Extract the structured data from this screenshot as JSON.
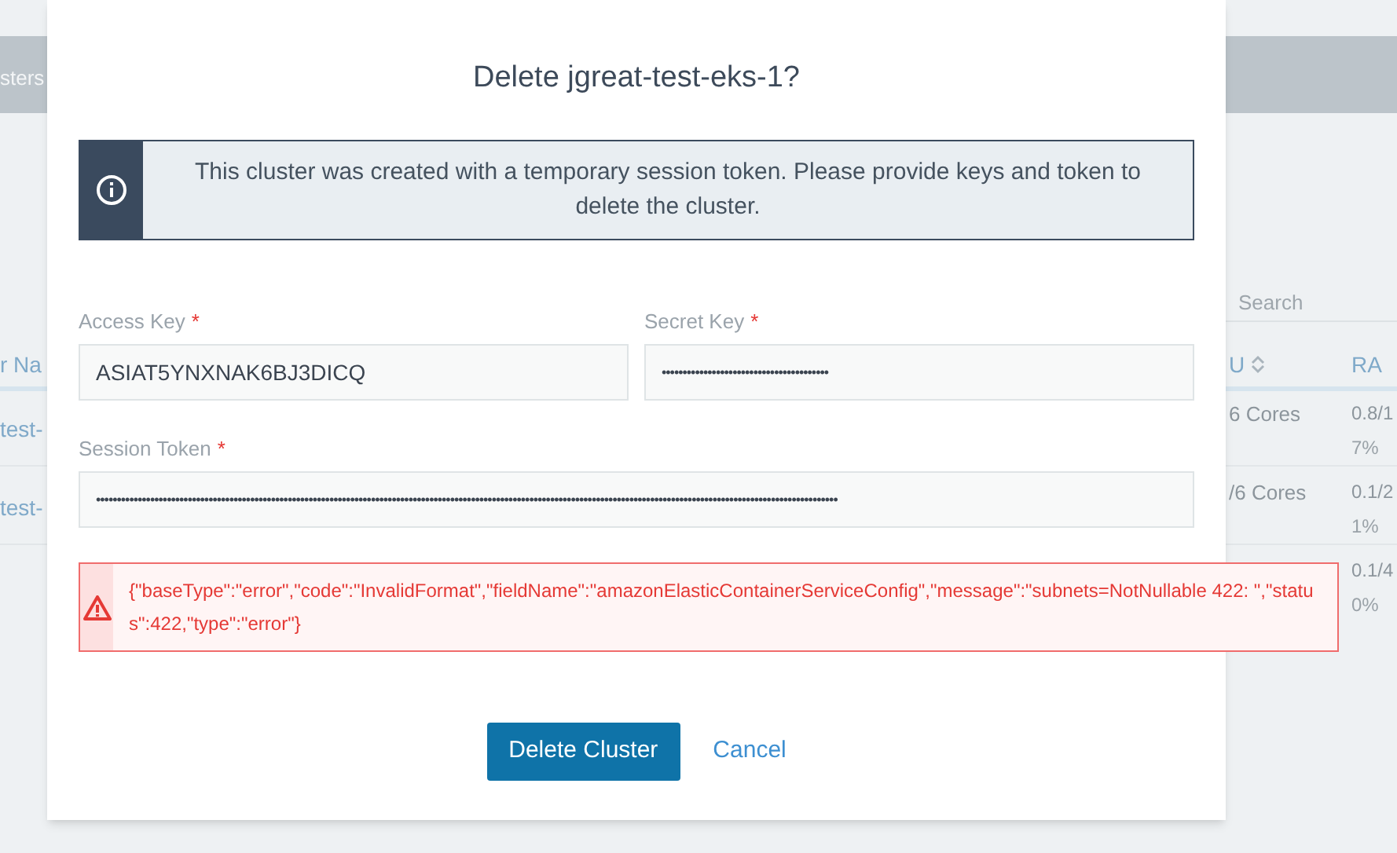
{
  "background": {
    "header_fragment": "sters",
    "search": {
      "placeholder": "Search"
    },
    "left_column": {
      "heading": "r Na",
      "rows": [
        "test-",
        "test-"
      ]
    },
    "right_columns": [
      {
        "heading": "U",
        "sortable": true
      },
      {
        "heading": "RA",
        "sortable": false
      }
    ],
    "right_rows": [
      {
        "cpu": "6 Cores",
        "ram": "0.8/1",
        "ram_pct": "7%"
      },
      {
        "cpu": "/6 Cores",
        "ram": "0.1/2",
        "ram_pct": "1%"
      },
      {
        "cpu": "",
        "ram": "0.1/4",
        "ram_pct": "0%"
      }
    ]
  },
  "dialog": {
    "title": "Delete jgreat-test-eks-1?",
    "info": "This cluster was created with a temporary session token. Please provide keys and token to delete the cluster.",
    "fields": [
      {
        "label": "Access Key",
        "required_mark": "*",
        "value": "ASIAT5YNXNAK6BJ3DICQ",
        "kind": "text",
        "wide": false
      },
      {
        "label": "Secret Key",
        "required_mark": "*",
        "value": "••••••••••••••••••••••••••••••••••••••••",
        "kind": "password",
        "wide": false
      },
      {
        "label": "Session Token",
        "required_mark": "*",
        "value": "••••••••••••••••••••••••••••••••••••••••••••••••••••••••••••••••••••••••••••••••••••••••••••••••••••••••••••••••••••••••••••••••••••••••••••••••••••••••••••••••••••••••••••••••••",
        "kind": "password",
        "wide": true
      }
    ],
    "error": "{\"baseType\":\"error\",\"code\":\"InvalidFormat\",\"fieldName\":\"amazonElasticContainerServiceConfig\",\"message\":\"subnets=NotNullable 422: \",\"status\":422,\"type\":\"error\"}",
    "buttons": [
      {
        "label": "Delete Cluster",
        "kind": "primary"
      },
      {
        "label": "Cancel",
        "kind": "link"
      }
    ]
  }
}
